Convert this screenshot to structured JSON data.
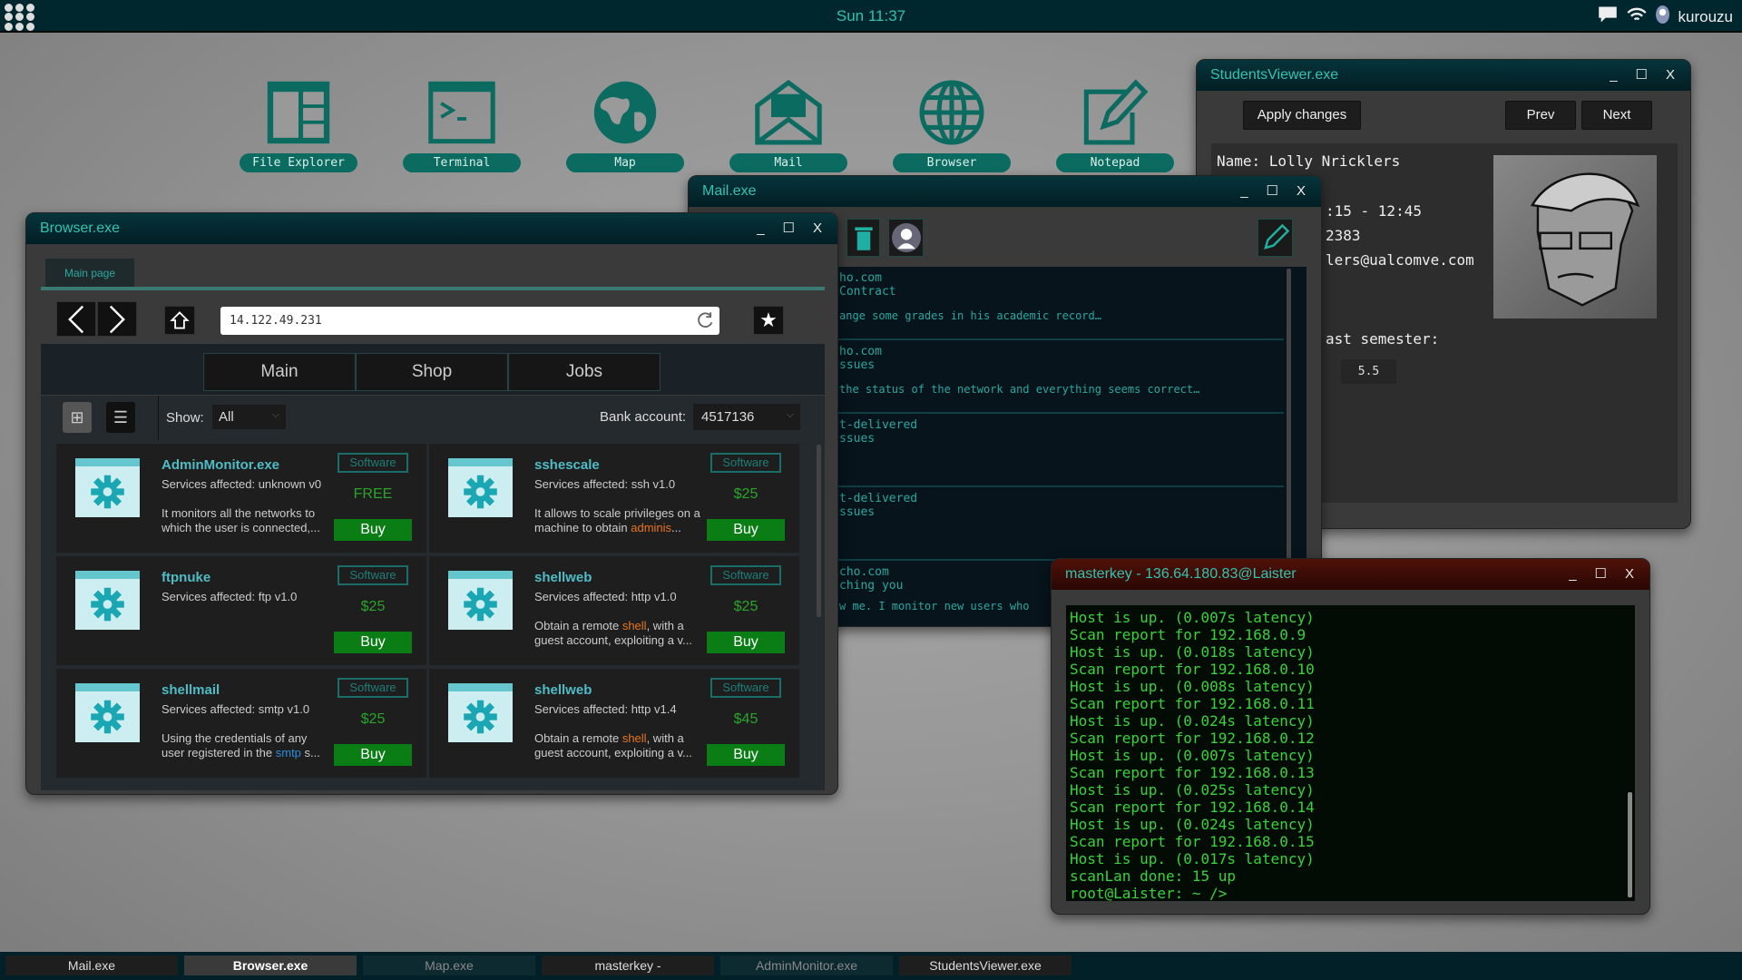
{
  "topbar": {
    "clock": "Sun 11:37",
    "user": "kurouzu"
  },
  "desktop_icons": [
    {
      "label": "File Explorer"
    },
    {
      "label": "Terminal"
    },
    {
      "label": "Map"
    },
    {
      "label": "Mail"
    },
    {
      "label": "Browser"
    },
    {
      "label": "Notepad"
    }
  ],
  "students": {
    "title": "StudentsViewer.exe",
    "apply": "Apply changes",
    "prev": "Prev",
    "next": "Next",
    "name": "Name: Lolly Nricklers",
    "time": ":15 - 12:45",
    "id": "2383",
    "email": "lers@ualcomve.com",
    "semester": "ast semester:",
    "grade": "5.5"
  },
  "mail": {
    "title": "Mail.exe",
    "items": [
      {
        "from": "ho.com",
        "subject": " Contract",
        "body": "ange some grades in his academic record…"
      },
      {
        "from": "ho.com",
        "subject": "ssues",
        "body": " the status of the network and everything seems correct…"
      },
      {
        "from": "t-delivered",
        "subject": "ssues",
        "body": ""
      },
      {
        "from": "t-delivered",
        "subject": "ssues",
        "body": ""
      },
      {
        "from": "cho.com",
        "subject": "ching you",
        "body": "w me. I monitor new users who"
      }
    ]
  },
  "browser": {
    "title": "Browser.exe",
    "tab": "Main page",
    "url": "14.122.49.231",
    "nav_tabs": [
      "Main",
      "Shop",
      "Jobs"
    ],
    "show_label": "Show:",
    "show_value": "All",
    "bank_label": "Bank account:",
    "bank_value": "4517136",
    "items": [
      {
        "name": "AdminMonitor.exe",
        "services": "Services affected: unknown v0",
        "tag": "Software",
        "price": "FREE",
        "buy": "Buy",
        "desc1": "It monitors all the networks to which the user is connected,...",
        "hl": "",
        "desc2": ""
      },
      {
        "name": "sshescale",
        "services": "Services affected: ssh v1.0",
        "tag": "Software",
        "price": "$25",
        "buy": "Buy",
        "desc1": "It allows to scale privileges on a machine to obtain ",
        "hl": "adminis",
        "desc2": "..."
      },
      {
        "name": "ftpnuke",
        "services": "Services affected: ftp v1.0",
        "tag": "Software",
        "price": "$25",
        "buy": "Buy",
        "desc1": "",
        "hl": "",
        "desc2": ""
      },
      {
        "name": "shellweb",
        "services": "Services affected: http v1.0",
        "tag": "Software",
        "price": "$25",
        "buy": "Buy",
        "desc1": "Obtain a remote ",
        "hl": "shell",
        "desc2": ", with a guest account, exploiting a v..."
      },
      {
        "name": "shellmail",
        "services": "Services affected: smtp v1.0",
        "tag": "Software",
        "price": "$25",
        "buy": "Buy",
        "desc1": "Using the credentials of any user registered in the ",
        "hl": "smtp",
        "desc2": " s..."
      },
      {
        "name": "shellweb",
        "services": "Services affected: http v1.4",
        "tag": "Software",
        "price": "$45",
        "buy": "Buy",
        "desc1": "Obtain a remote ",
        "hl": "shell",
        "desc2": ", with a guest account, exploiting a v..."
      }
    ]
  },
  "terminal": {
    "title": "masterkey - 136.64.180.83@Laister",
    "lines": [
      "Host is up. (0.007s latency)",
      "Scan report for 192.168.0.9",
      "Host is up. (0.018s latency)",
      "Scan report for 192.168.0.10",
      "Host is up. (0.008s latency)",
      "Scan report for 192.168.0.11",
      "Host is up. (0.024s latency)",
      "Scan report for 192.168.0.12",
      "Host is up. (0.007s latency)",
      "Scan report for 192.168.0.13",
      "Host is up. (0.025s latency)",
      "Scan report for 192.168.0.14",
      "Host is up. (0.024s latency)",
      "Scan report for 192.168.0.15",
      "Host is up. (0.017s latency)",
      "scanLan done: 15 up",
      "root@Laister: ~ />"
    ]
  },
  "taskbar": [
    {
      "label": "Mail.exe",
      "state": "open"
    },
    {
      "label": "Browser.exe",
      "state": "active"
    },
    {
      "label": "Map.exe",
      "state": "minimized"
    },
    {
      "label": "masterkey -",
      "state": "open"
    },
    {
      "label": "AdminMonitor.exe",
      "state": "minimized"
    },
    {
      "label": "StudentsViewer.exe",
      "state": "open"
    }
  ],
  "window_controls": {
    "min": "_",
    "max": "☐",
    "close": "X"
  },
  "colors": {
    "accent": "#33c3b2",
    "buy": "#0a7d14",
    "terminal_text": "#3bd13b",
    "terminal_title": "#4a0e06"
  }
}
